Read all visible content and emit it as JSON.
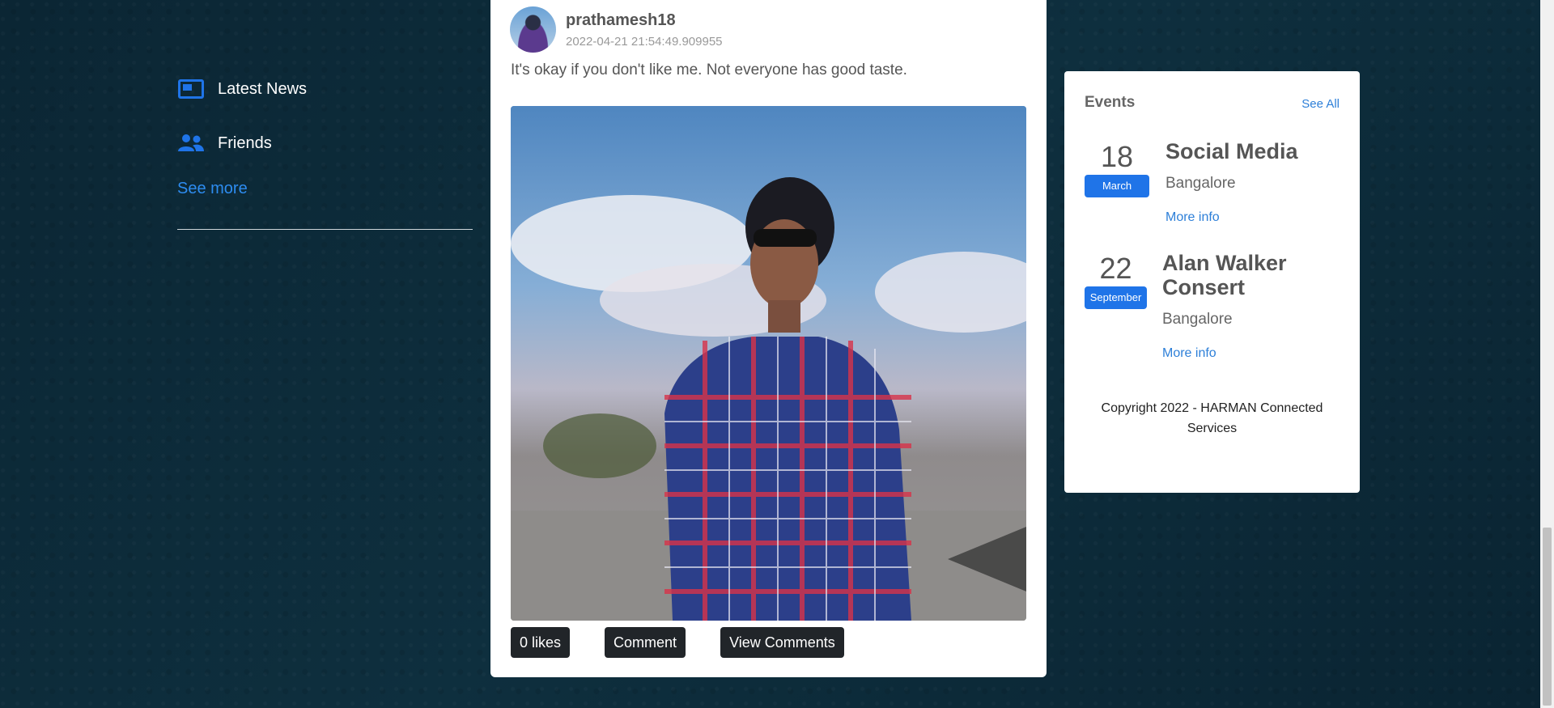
{
  "sidebar": {
    "items": [
      {
        "label": "Latest News",
        "icon": "news-icon"
      },
      {
        "label": "Friends",
        "icon": "friends-icon"
      }
    ],
    "see_more": "See more"
  },
  "post": {
    "username": "prathamesh18",
    "timestamp": "2022-04-21 21:54:49.909955",
    "text": "It's okay if you don't like me. Not everyone has good taste.",
    "actions": {
      "likes": "0 likes",
      "comment": "Comment",
      "view_comments": "View Comments"
    }
  },
  "events": {
    "title": "Events",
    "see_all": "See All",
    "items": [
      {
        "day": "18",
        "month": "March",
        "title": "Social Media",
        "location": "Bangalore",
        "more": "More info"
      },
      {
        "day": "22",
        "month": "September",
        "title": "Alan Walker Consert",
        "location": "Bangalore",
        "more": "More info"
      }
    ],
    "copyright": "Copyright 2022 - HARMAN Connected Services"
  },
  "colors": {
    "accent": "#1f74e8",
    "link": "#2d8cf0",
    "dark_button": "#212529",
    "background": "#0c2a38"
  }
}
